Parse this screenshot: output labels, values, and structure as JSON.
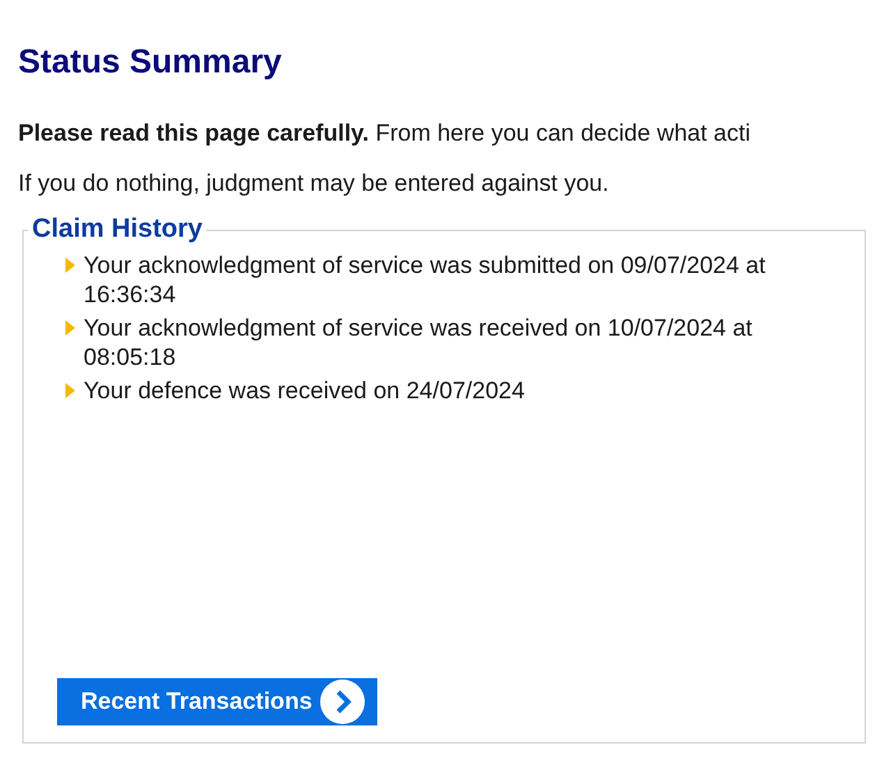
{
  "heading": "Status Summary",
  "intro": "**Please read this page carefully.** From here you can decide what acti",
  "warning": "If you do nothing, judgment may be entered against you.",
  "claim_history": {
    "legend": "Claim History",
    "items": [
      "Your acknowledgment of service was submitted on 09/07/2024 at 16:36:34",
      "Your acknowledgment of service was received on 10/07/2024 at 08:05:18",
      "Your defence was received on 24/07/2024"
    ],
    "button": "Recent Transactions"
  }
}
